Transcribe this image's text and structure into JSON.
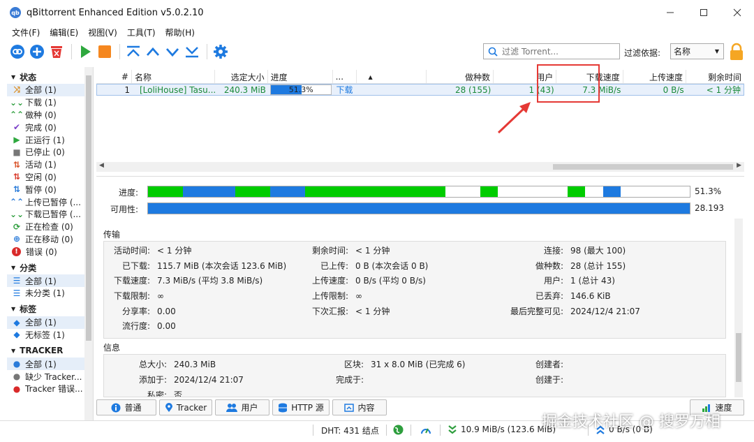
{
  "window": {
    "title": "qBittorrent Enhanced Edition v5.0.2.10",
    "app_icon": "qb"
  },
  "menu": [
    "文件(F)",
    "编辑(E)",
    "视图(V)",
    "工具(T)",
    "帮助(H)"
  ],
  "toolbar": {
    "search_placeholder": "过滤 Torrent...",
    "filter_label": "过滤依据:",
    "filter_value": "名称"
  },
  "sidebar": {
    "status_header": "状态",
    "status_items": [
      {
        "label": "全部 (1)",
        "icon": "all-icon",
        "color": "#d98b1e"
      },
      {
        "label": "下载 (1)",
        "icon": "download-icon",
        "color": "#2e9e3e"
      },
      {
        "label": "做种 (0)",
        "icon": "seed-icon",
        "color": "#2e9e3e"
      },
      {
        "label": "完成 (0)",
        "icon": "check-icon",
        "color": "#7a3fc8"
      },
      {
        "label": "正运行 (1)",
        "icon": "play-icon",
        "color": "#2ea83e"
      },
      {
        "label": "已停止 (0)",
        "icon": "stop-icon",
        "color": "#777777"
      },
      {
        "label": "活动 (1)",
        "icon": "active-icon",
        "color": "#d9532a"
      },
      {
        "label": "空闲 (0)",
        "icon": "idle-icon",
        "color": "#d93a2a"
      },
      {
        "label": "暂停 (0)",
        "icon": "pause-icon",
        "color": "#2a7bd9"
      },
      {
        "label": "上传已暂停 (...",
        "icon": "upload-paused-icon",
        "color": "#2a7bd9"
      },
      {
        "label": "下载已暂停 (...",
        "icon": "download-paused-icon",
        "color": "#2e9e3e"
      },
      {
        "label": "正在检查 (0)",
        "icon": "checking-icon",
        "color": "#2e9e3e"
      },
      {
        "label": "正在移动 (0)",
        "icon": "moving-icon",
        "color": "#2a7bd9"
      },
      {
        "label": "错误 (0)",
        "icon": "error-icon",
        "color": "#d92a2a"
      }
    ],
    "category_header": "分类",
    "category_items": [
      {
        "label": "全部 (1)",
        "icon": "list-icon"
      },
      {
        "label": "未分类 (1)",
        "icon": "list-icon"
      }
    ],
    "tag_header": "标签",
    "tag_items": [
      {
        "label": "全部 (1)",
        "icon": "tag-icon"
      },
      {
        "label": "无标签 (1)",
        "icon": "tag-icon"
      }
    ],
    "tracker_header": "TRACKER",
    "tracker_items": [
      {
        "label": "全部 (1)",
        "icon": "pin-icon",
        "color": "#2a7bd9"
      },
      {
        "label": "缺少 Tracker...",
        "icon": "pin-icon",
        "color": "#777777"
      },
      {
        "label": "Tracker 错误...",
        "icon": "pin-icon",
        "color": "#d92a2a"
      }
    ]
  },
  "torrent_list": {
    "headers": {
      "num": "#",
      "name": "名称",
      "size": "选定大小",
      "progress": "进度",
      "status": "...",
      "seeds": "做种数",
      "peers": "用户",
      "down_speed": "下载速度",
      "up_speed": "上传速度",
      "eta": "剩余时间"
    },
    "rows": [
      {
        "num": "1",
        "name": "[LoliHouse] Tasu...",
        "size": "240.3 MiB",
        "progress_text": "51.3%",
        "progress": 0.513,
        "status": "下载",
        "seeds": "28 (155)",
        "peers": "1 (43)",
        "down_speed": "7.3 MiB/s",
        "up_speed": "0 B/s",
        "eta": "< 1 分钟"
      }
    ]
  },
  "properties": {
    "progress_label": "进度:",
    "progress_value": "51.3%",
    "availability_label": "可用性:",
    "availability_value": "28.193",
    "transfer_title": "传输",
    "transfer": {
      "active_time": {
        "k": "活动时间:",
        "v": "< 1 分钟"
      },
      "downloaded": {
        "k": "已下载:",
        "v": "115.7 MiB (本次会话 123.6 MiB)"
      },
      "dl_speed": {
        "k": "下载速度:",
        "v": "7.3 MiB/s (平均 3.8 MiB/s)"
      },
      "dl_limit": {
        "k": "下载限制:",
        "v": "∞"
      },
      "share_ratio": {
        "k": "分享率:",
        "v": "0.00"
      },
      "popularity": {
        "k": "流行度:",
        "v": "0.00"
      },
      "eta": {
        "k": "剩余时间:",
        "v": "< 1 分钟"
      },
      "uploaded": {
        "k": "已上传:",
        "v": "0 B (本次会话 0 B)"
      },
      "ul_speed": {
        "k": "上传速度:",
        "v": "0 B/s (平均 0 B/s)"
      },
      "ul_limit": {
        "k": "上传限制:",
        "v": "∞"
      },
      "reannounce": {
        "k": "下次汇报:",
        "v": "< 1 分钟"
      },
      "connections": {
        "k": "连接:",
        "v": "98 (最大 100)"
      },
      "seeds": {
        "k": "做种数:",
        "v": "28 (总计 155)"
      },
      "peers": {
        "k": "用户:",
        "v": "1 (总计 43)"
      },
      "wasted": {
        "k": "已丢弃:",
        "v": "146.6 KiB"
      },
      "last_complete": {
        "k": "最后完整可见:",
        "v": "2024/12/4 21:07"
      }
    },
    "info_title": "信息",
    "info": {
      "total_size": {
        "k": "总大小:",
        "v": "240.3 MiB"
      },
      "added_on": {
        "k": "添加于:",
        "v": "2024/12/4 21:07"
      },
      "private": {
        "k": "私密:",
        "v": "否"
      },
      "pieces": {
        "k": "区块:",
        "v": "31 x 8.0 MiB (已完成 6)"
      },
      "completed_on": {
        "k": "完成于:",
        "v": ""
      },
      "created_by": {
        "k": "创建者:",
        "v": ""
      },
      "created_on": {
        "k": "创建于:",
        "v": ""
      }
    }
  },
  "tabs": [
    "普通",
    "Tracker",
    "用户",
    "HTTP 源",
    "内容"
  ],
  "speed_tab": "速度",
  "status_bar": {
    "dht": "DHT: 431 结点",
    "download": "10.9 MiB/s (123.6 MiB)",
    "upload": "0 B/s (0 B)"
  },
  "watermark": "掘金技术社区 @ 搜罗万相",
  "colors": {
    "accent": "#1e7ae0",
    "green": "#00cc00",
    "highlight": "#e53935"
  }
}
